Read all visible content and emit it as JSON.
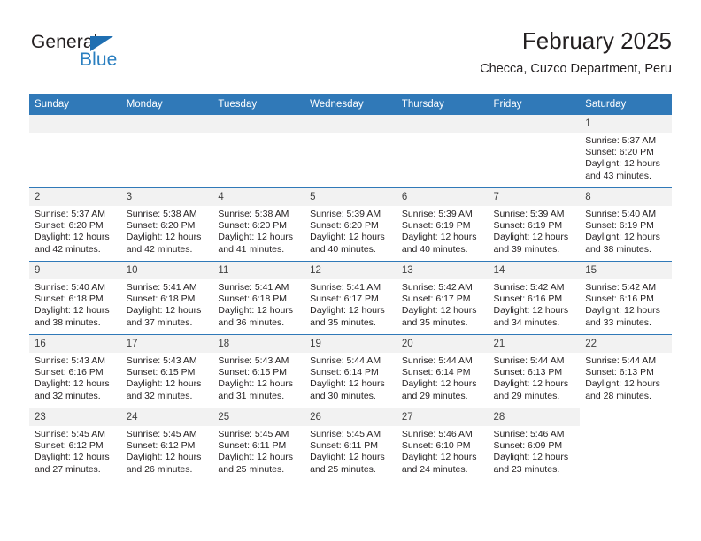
{
  "brand": {
    "name_top": "General",
    "name_bottom": "Blue",
    "triangle_color": "#1f6fb2",
    "blue_color": "#2a7fc0"
  },
  "header": {
    "title": "February 2025",
    "subtitle": "Checca, Cuzco Department, Peru"
  },
  "theme": {
    "header_row_bg": "#3079b8",
    "daynum_bg": "#f2f2f2",
    "cell_border": "#3079b8",
    "text": "#231f20"
  },
  "calendar": {
    "weekday_headers": [
      "Sunday",
      "Monday",
      "Tuesday",
      "Wednesday",
      "Thursday",
      "Friday",
      "Saturday"
    ],
    "labels": {
      "sunrise": "Sunrise:",
      "sunset": "Sunset:",
      "daylight": "Daylight:"
    },
    "weeks": [
      [
        {
          "day": "",
          "blank": true
        },
        {
          "day": "",
          "blank": true
        },
        {
          "day": "",
          "blank": true
        },
        {
          "day": "",
          "blank": true
        },
        {
          "day": "",
          "blank": true
        },
        {
          "day": "",
          "blank": true
        },
        {
          "day": "1",
          "sunrise": "Sunrise: 5:37 AM",
          "sunset": "Sunset: 6:20 PM",
          "daylight": "Daylight: 12 hours and 43 minutes."
        }
      ],
      [
        {
          "day": "2",
          "sunrise": "Sunrise: 5:37 AM",
          "sunset": "Sunset: 6:20 PM",
          "daylight": "Daylight: 12 hours and 42 minutes."
        },
        {
          "day": "3",
          "sunrise": "Sunrise: 5:38 AM",
          "sunset": "Sunset: 6:20 PM",
          "daylight": "Daylight: 12 hours and 42 minutes."
        },
        {
          "day": "4",
          "sunrise": "Sunrise: 5:38 AM",
          "sunset": "Sunset: 6:20 PM",
          "daylight": "Daylight: 12 hours and 41 minutes."
        },
        {
          "day": "5",
          "sunrise": "Sunrise: 5:39 AM",
          "sunset": "Sunset: 6:20 PM",
          "daylight": "Daylight: 12 hours and 40 minutes."
        },
        {
          "day": "6",
          "sunrise": "Sunrise: 5:39 AM",
          "sunset": "Sunset: 6:19 PM",
          "daylight": "Daylight: 12 hours and 40 minutes."
        },
        {
          "day": "7",
          "sunrise": "Sunrise: 5:39 AM",
          "sunset": "Sunset: 6:19 PM",
          "daylight": "Daylight: 12 hours and 39 minutes."
        },
        {
          "day": "8",
          "sunrise": "Sunrise: 5:40 AM",
          "sunset": "Sunset: 6:19 PM",
          "daylight": "Daylight: 12 hours and 38 minutes."
        }
      ],
      [
        {
          "day": "9",
          "sunrise": "Sunrise: 5:40 AM",
          "sunset": "Sunset: 6:18 PM",
          "daylight": "Daylight: 12 hours and 38 minutes."
        },
        {
          "day": "10",
          "sunrise": "Sunrise: 5:41 AM",
          "sunset": "Sunset: 6:18 PM",
          "daylight": "Daylight: 12 hours and 37 minutes."
        },
        {
          "day": "11",
          "sunrise": "Sunrise: 5:41 AM",
          "sunset": "Sunset: 6:18 PM",
          "daylight": "Daylight: 12 hours and 36 minutes."
        },
        {
          "day": "12",
          "sunrise": "Sunrise: 5:41 AM",
          "sunset": "Sunset: 6:17 PM",
          "daylight": "Daylight: 12 hours and 35 minutes."
        },
        {
          "day": "13",
          "sunrise": "Sunrise: 5:42 AM",
          "sunset": "Sunset: 6:17 PM",
          "daylight": "Daylight: 12 hours and 35 minutes."
        },
        {
          "day": "14",
          "sunrise": "Sunrise: 5:42 AM",
          "sunset": "Sunset: 6:16 PM",
          "daylight": "Daylight: 12 hours and 34 minutes."
        },
        {
          "day": "15",
          "sunrise": "Sunrise: 5:42 AM",
          "sunset": "Sunset: 6:16 PM",
          "daylight": "Daylight: 12 hours and 33 minutes."
        }
      ],
      [
        {
          "day": "16",
          "sunrise": "Sunrise: 5:43 AM",
          "sunset": "Sunset: 6:16 PM",
          "daylight": "Daylight: 12 hours and 32 minutes."
        },
        {
          "day": "17",
          "sunrise": "Sunrise: 5:43 AM",
          "sunset": "Sunset: 6:15 PM",
          "daylight": "Daylight: 12 hours and 32 minutes."
        },
        {
          "day": "18",
          "sunrise": "Sunrise: 5:43 AM",
          "sunset": "Sunset: 6:15 PM",
          "daylight": "Daylight: 12 hours and 31 minutes."
        },
        {
          "day": "19",
          "sunrise": "Sunrise: 5:44 AM",
          "sunset": "Sunset: 6:14 PM",
          "daylight": "Daylight: 12 hours and 30 minutes."
        },
        {
          "day": "20",
          "sunrise": "Sunrise: 5:44 AM",
          "sunset": "Sunset: 6:14 PM",
          "daylight": "Daylight: 12 hours and 29 minutes."
        },
        {
          "day": "21",
          "sunrise": "Sunrise: 5:44 AM",
          "sunset": "Sunset: 6:13 PM",
          "daylight": "Daylight: 12 hours and 29 minutes."
        },
        {
          "day": "22",
          "sunrise": "Sunrise: 5:44 AM",
          "sunset": "Sunset: 6:13 PM",
          "daylight": "Daylight: 12 hours and 28 minutes."
        }
      ],
      [
        {
          "day": "23",
          "sunrise": "Sunrise: 5:45 AM",
          "sunset": "Sunset: 6:12 PM",
          "daylight": "Daylight: 12 hours and 27 minutes."
        },
        {
          "day": "24",
          "sunrise": "Sunrise: 5:45 AM",
          "sunset": "Sunset: 6:12 PM",
          "daylight": "Daylight: 12 hours and 26 minutes."
        },
        {
          "day": "25",
          "sunrise": "Sunrise: 5:45 AM",
          "sunset": "Sunset: 6:11 PM",
          "daylight": "Daylight: 12 hours and 25 minutes."
        },
        {
          "day": "26",
          "sunrise": "Sunrise: 5:45 AM",
          "sunset": "Sunset: 6:11 PM",
          "daylight": "Daylight: 12 hours and 25 minutes."
        },
        {
          "day": "27",
          "sunrise": "Sunrise: 5:46 AM",
          "sunset": "Sunset: 6:10 PM",
          "daylight": "Daylight: 12 hours and 24 minutes."
        },
        {
          "day": "28",
          "sunrise": "Sunrise: 5:46 AM",
          "sunset": "Sunset: 6:09 PM",
          "daylight": "Daylight: 12 hours and 23 minutes."
        },
        {
          "day": "",
          "blank": true,
          "trailing": true
        }
      ]
    ]
  }
}
